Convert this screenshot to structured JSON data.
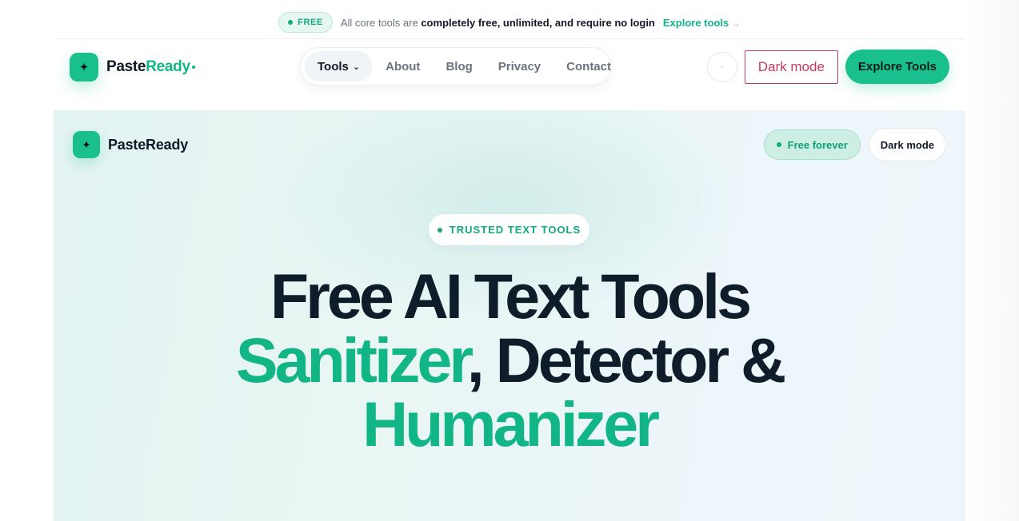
{
  "announcement": {
    "badge": "FREE",
    "prefix": "All core tools are",
    "bold": "completely free, unlimited, and require no login",
    "link": "Explore tools",
    "link_arrow": "→"
  },
  "nav": {
    "logo_icon": "✦",
    "logo_name_dark": "Paste",
    "logo_name_accent": "Ready",
    "menu": [
      {
        "label": "Tools",
        "chevron": "⌄"
      },
      {
        "label": "About"
      },
      {
        "label": "Blog"
      },
      {
        "label": "Privacy"
      },
      {
        "label": "Contact"
      }
    ],
    "theme_toggle_glyph": "◦",
    "dark_mode": "Dark mode",
    "cta": "Explore Tools"
  },
  "hero": {
    "logo_icon": "✦",
    "logo_name": "PasteReady",
    "free_pill": "Free forever",
    "dark_mode": "Dark mode",
    "eyebrow": "TRUSTED TEXT TOOLS",
    "headline": {
      "line1": "Free AI Text Tools",
      "line2_green": "Sanitizer",
      "line2_rest": ", Detector &",
      "line3": "Humanizer"
    }
  },
  "colors": {
    "accent": "#19c08d",
    "accent_text": "#12b586",
    "dark_mode_outline": "#c8385f",
    "heading": "#0f1d2a"
  }
}
